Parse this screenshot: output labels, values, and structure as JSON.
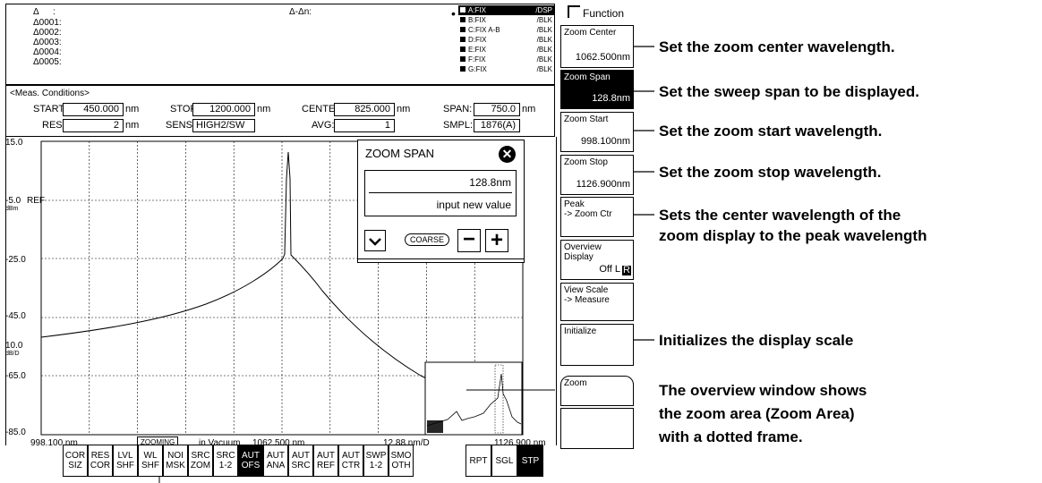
{
  "function_title": "Function",
  "marker": {
    "delta": "Δ",
    "colon": ":",
    "rows": [
      "Δ0001:",
      "Δ0002:",
      "Δ0003:",
      "Δ0004:",
      "Δ0005:"
    ],
    "delta_dn": "Δ-Δn:"
  },
  "traces": [
    {
      "name": "A:FIX",
      "mode": "/DSP",
      "active": true
    },
    {
      "name": "B:FIX",
      "mode": "/BLK",
      "active": false
    },
    {
      "name": "C:FIX A-B",
      "mode": "/BLK",
      "active": false
    },
    {
      "name": "D:FIX",
      "mode": "/BLK",
      "active": false
    },
    {
      "name": "E:FIX",
      "mode": "/BLK",
      "active": false
    },
    {
      "name": "F:FIX",
      "mode": "/BLK",
      "active": false
    },
    {
      "name": "G:FIX",
      "mode": "/BLK",
      "active": false
    }
  ],
  "meas": {
    "heading": "<Meas. Conditions>",
    "start_label": "START:",
    "start_value": "450.000",
    "start_unit": "nm",
    "stop_label": "STOP:",
    "stop_value": "1200.000",
    "stop_unit": "nm",
    "center_label": "CENTER:",
    "center_value": "825.000",
    "center_unit": "nm",
    "span_label": "SPAN:",
    "span_value": "750.0",
    "span_unit": "nm",
    "res_label": "RES:",
    "res_value": "2",
    "res_unit": "nm",
    "sens_label": "SENS:",
    "sens_value": "HIGH2/SW",
    "avg_label": "AVG:",
    "avg_value": "1",
    "smpl_label": "SMPL:",
    "smpl_value": "1876(A)"
  },
  "graph": {
    "y_labels": [
      "15.0",
      "-5.0",
      "-25.0",
      "-45.0",
      "-65.0",
      "-85.0"
    ],
    "ref_label": "REF",
    "ref_unit": "dBm",
    "scale_value": "10.0",
    "scale_unit": "dB/D",
    "x_start": "998.100 nm",
    "zooming": "ZOOMING",
    "medium": "in Vacuum",
    "x_center": "1062.500 nm",
    "x_div": "12.88 nm/D",
    "x_stop": "1126.900 nm"
  },
  "zoom_dialog": {
    "title": "ZOOM SPAN",
    "value": "128.8nm",
    "hint": "input new value",
    "coarse": "COARSE"
  },
  "softkeys": [
    {
      "title": "Zoom Center",
      "value": "1062.500nm",
      "selected": false
    },
    {
      "title": "Zoom Span",
      "value": "128.8nm",
      "selected": true
    },
    {
      "title": "Zoom Start",
      "value": "998.100nm",
      "selected": false
    },
    {
      "title": "Zoom Stop",
      "value": "1126.900nm",
      "selected": false
    },
    {
      "title": "Peak\n-> Zoom Ctr",
      "value": "",
      "selected": false
    },
    {
      "title": "Overview\nDisplay",
      "value": "Off L",
      "value_hl": "R",
      "selected": false
    },
    {
      "title": "View Scale\n-> Measure",
      "value": "",
      "selected": false
    },
    {
      "title": "Initialize",
      "value": "",
      "selected": false
    },
    {
      "title": "Zoom",
      "value": "",
      "selected": false
    },
    {
      "title": "",
      "value": "",
      "selected": false
    }
  ],
  "bottom_keys": [
    {
      "label": "COR\nSIZ",
      "on": false
    },
    {
      "label": "RES\nCOR",
      "on": false
    },
    {
      "label": "LVL\nSHF",
      "on": false
    },
    {
      "label": "WL\nSHF",
      "on": false
    },
    {
      "label": "NOI\nMSK",
      "on": false
    },
    {
      "label": "SRC\nZOM",
      "on": false
    },
    {
      "label": "SRC\n1-2",
      "on": false
    },
    {
      "label": "AUT\nOFS",
      "on": true
    },
    {
      "label": "AUT\nANA",
      "on": false
    },
    {
      "label": "AUT\nSRC",
      "on": false
    },
    {
      "label": "AUT\nREF",
      "on": false
    },
    {
      "label": "AUT\nCTR",
      "on": false
    },
    {
      "label": "SWP\n1-2",
      "on": false
    },
    {
      "label": "SMO\nOTH",
      "on": false
    }
  ],
  "sweep_keys": [
    {
      "label": "RPT",
      "on": false
    },
    {
      "label": "SGL",
      "on": false
    },
    {
      "label": "STP",
      "on": true
    }
  ],
  "callouts": {
    "c1": "Set the zoom center wavelength.",
    "c2": "Set the sweep span to be displayed.",
    "c3": "Set the zoom start wavelength.",
    "c4": "Set the zoom stop wavelength.",
    "c5a": "Sets the center wavelength of the",
    "c5b": "zoom display to the peak wavelength",
    "c6": "Initializes the display scale",
    "c7a": "The overview window shows",
    "c7b": "the zoom area (Zoom Area)",
    "c7c": "with a dotted frame."
  }
}
